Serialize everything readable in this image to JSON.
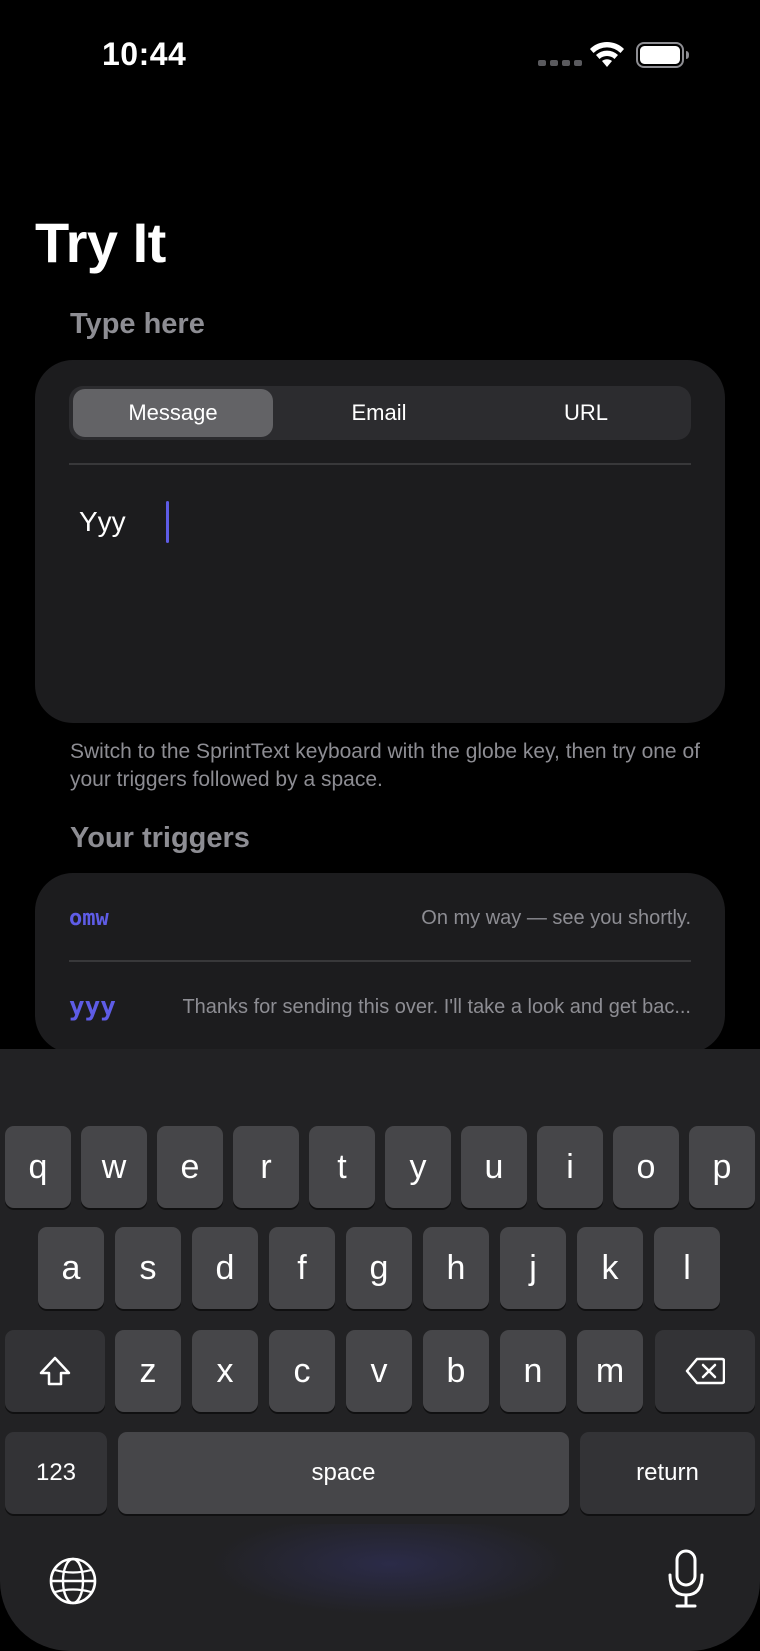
{
  "status": {
    "time": "10:44"
  },
  "title": "Try It",
  "type_section": {
    "header": "Type here",
    "tabs": [
      {
        "label": "Message",
        "selected": true
      },
      {
        "label": "Email",
        "selected": false
      },
      {
        "label": "URL",
        "selected": false
      }
    ],
    "text_value": "Yyy",
    "footnote": "Switch to the SprintText keyboard with the globe key, then try one of your triggers followed by a space."
  },
  "triggers_section": {
    "header": "Your triggers",
    "items": [
      {
        "trigger": "omw",
        "expansion": "On my way — see you shortly."
      },
      {
        "trigger": "yyy",
        "expansion": "Thanks for sending this over. I'll take a look and get bac..."
      }
    ]
  },
  "keyboard": {
    "row1": [
      "q",
      "w",
      "e",
      "r",
      "t",
      "y",
      "u",
      "i",
      "o",
      "p"
    ],
    "row2": [
      "a",
      "s",
      "d",
      "f",
      "g",
      "h",
      "j",
      "k",
      "l"
    ],
    "row3": [
      "z",
      "x",
      "c",
      "v",
      "b",
      "n",
      "m"
    ],
    "numbers_label": "123",
    "space_label": "space",
    "return_label": "return"
  },
  "colors": {
    "accent": "#5e5ce6",
    "background": "#000000",
    "card": "#1c1c1e",
    "secondary_text": "#8d8d93"
  },
  "icons": [
    "wifi-icon",
    "battery-icon",
    "shift-icon",
    "delete-icon",
    "globe-icon",
    "microphone-icon"
  ]
}
